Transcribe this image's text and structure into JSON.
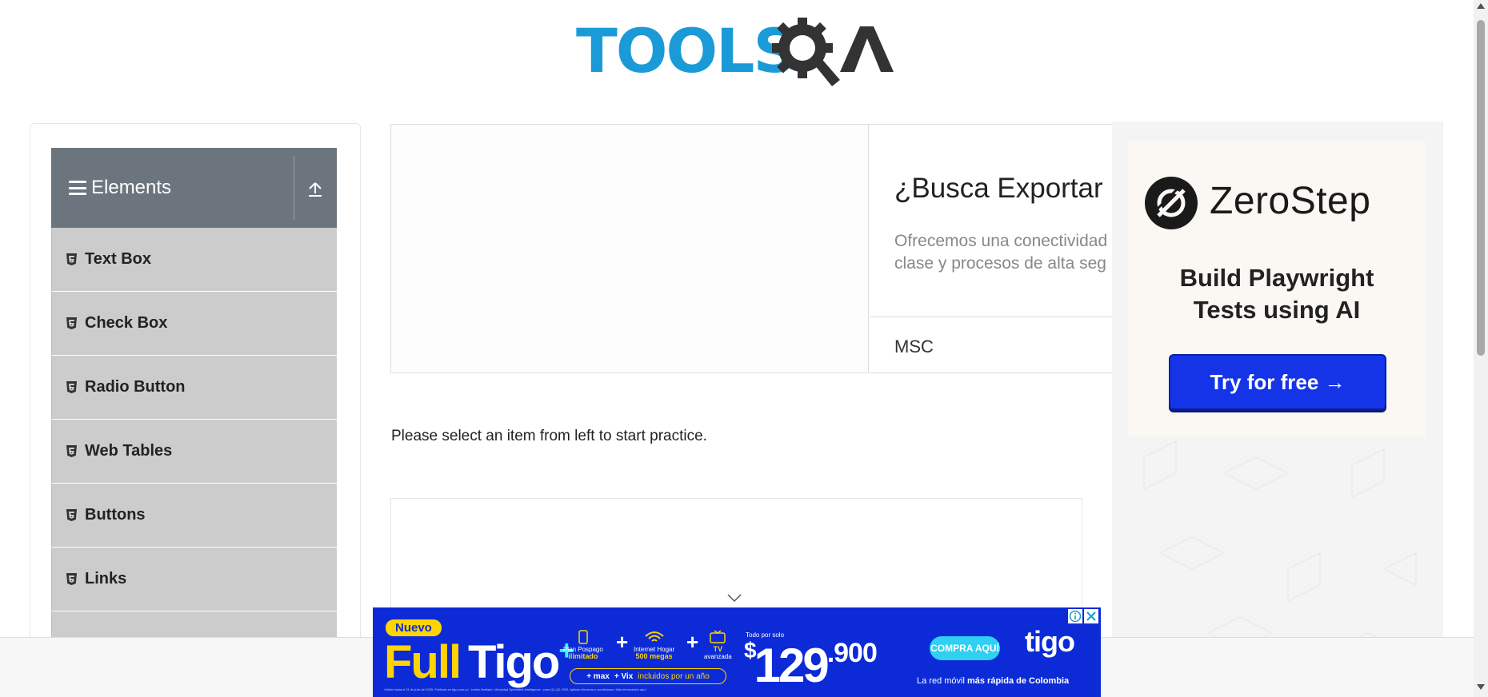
{
  "header": {
    "logo_text": "TOOLSQA"
  },
  "sidebar": {
    "group_title": "Elements",
    "items": [
      {
        "label": "Text Box"
      },
      {
        "label": "Check Box"
      },
      {
        "label": "Radio Button"
      },
      {
        "label": "Web Tables"
      },
      {
        "label": "Buttons"
      },
      {
        "label": "Links"
      },
      {
        "label": ""
      }
    ]
  },
  "top_ad": {
    "headline": "¿Busca Exportar",
    "body": "Ofrecemos una conectividad clase y procesos de alta seg",
    "brand": "MSC"
  },
  "main": {
    "instruction": "Please select an item from left to start practice."
  },
  "right_ad": {
    "brand": "ZeroStep",
    "tagline_line1": "Build Playwright",
    "tagline_line2": "Tests using AI",
    "cta": "Try for free →"
  },
  "banner": {
    "badge": "Nuevo",
    "full": "Full",
    "tigo": "Tigo",
    "plus_sup": "+",
    "feat1_a": "Plan Pospago",
    "feat1_b": "ilimitado",
    "feat2_a": "Internet Hogar",
    "feat2_b": "500 megas",
    "feat3_a": "TV",
    "feat3_b": "avanzada",
    "pill_a": "+ max",
    "pill_b": "+ Vix",
    "pill_c": "incluidos por un año",
    "desde": "Todo por solo",
    "price_currency": "$",
    "price_main": "129",
    "price_cents": ".900",
    "buy": "COMPRA AQUÍ",
    "logo": "tigo",
    "tagline_pre": "La red móvil ",
    "tagline_bold": "más rápida de Colombia",
    "fine": "Válido hasta el 31 de julio de 2025. Políticas en tigo.com.co · Indice ilimitado. Velocidad Speedtest Intelligence · para Q1-Q2 2025. Aplican términos y condiciones. Más información aquí"
  },
  "colors": {
    "accent": "#1a9bd7",
    "sidebar_header": "#6c757d",
    "sidebar_item": "#cccccc",
    "cta_blue": "#1534e8",
    "banner_blue": "#0c2bd6",
    "banner_yellow": "#ffd400"
  }
}
